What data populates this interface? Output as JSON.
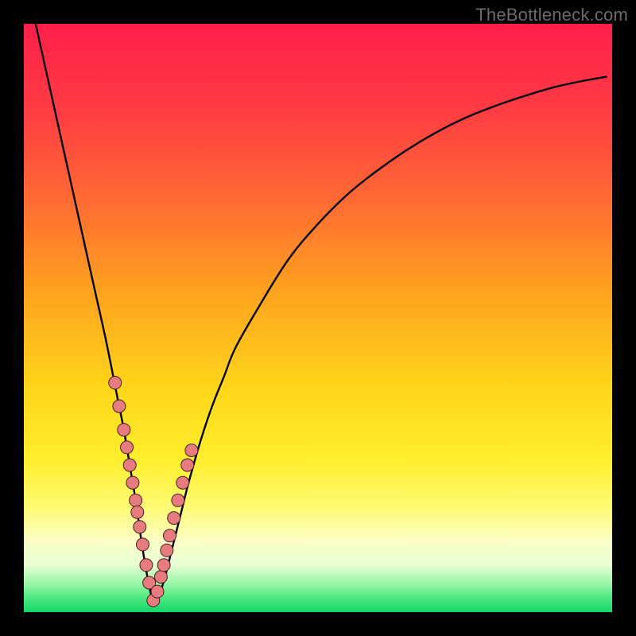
{
  "watermark": "TheBottleneck.com",
  "colors": {
    "frame": "#000000",
    "curve": "#000000",
    "marker_fill": "#e77c80",
    "marker_stroke": "#4a1f1f",
    "gradient_stops": [
      {
        "offset": 0.0,
        "color": "#ff1f4a"
      },
      {
        "offset": 0.14,
        "color": "#ff3a44"
      },
      {
        "offset": 0.3,
        "color": "#ff6a33"
      },
      {
        "offset": 0.46,
        "color": "#ffa41f"
      },
      {
        "offset": 0.62,
        "color": "#ffd61a"
      },
      {
        "offset": 0.74,
        "color": "#ffee2d"
      },
      {
        "offset": 0.82,
        "color": "#fffb72"
      },
      {
        "offset": 0.88,
        "color": "#fcffc6"
      },
      {
        "offset": 0.92,
        "color": "#e7ffd4"
      },
      {
        "offset": 0.95,
        "color": "#9ff7a8"
      },
      {
        "offset": 0.975,
        "color": "#4eea80"
      },
      {
        "offset": 1.0,
        "color": "#12d66a"
      }
    ]
  },
  "chart_data": {
    "type": "line",
    "title": "",
    "xlabel": "",
    "ylabel": "",
    "xlim": [
      0,
      100
    ],
    "ylim": [
      0,
      100
    ],
    "x_optimum": 22,
    "series": [
      {
        "name": "bottleneck-curve",
        "x": [
          2,
          4,
          6,
          8,
          10,
          12,
          14,
          16,
          17,
          18,
          19,
          20,
          21,
          22,
          23,
          24,
          25,
          26,
          27,
          28,
          30,
          32,
          34,
          36,
          40,
          45,
          50,
          55,
          60,
          65,
          70,
          75,
          80,
          85,
          90,
          95,
          99
        ],
        "y": [
          100,
          91,
          82,
          73,
          64,
          55,
          46,
          36,
          31,
          25,
          19,
          12,
          6,
          2,
          3,
          6,
          10,
          14,
          18,
          22,
          29,
          35,
          40,
          45,
          52,
          60,
          66,
          71,
          75,
          78.5,
          81.5,
          84,
          86,
          87.7,
          89.2,
          90.3,
          91
        ]
      }
    ],
    "markers": {
      "name": "highlight-points",
      "x": [
        15.5,
        16.2,
        17.0,
        17.5,
        18.0,
        18.5,
        19.0,
        19.3,
        19.7,
        20.2,
        20.8,
        21.3,
        22.0,
        22.7,
        23.3,
        23.8,
        24.3,
        24.8,
        25.5,
        26.2,
        27.0,
        27.8,
        28.5
      ],
      "y": [
        39,
        35,
        31,
        28,
        25,
        22,
        19,
        17,
        14.5,
        11.5,
        8,
        5,
        2,
        3.5,
        6,
        8,
        10.5,
        13,
        16,
        19,
        22,
        25,
        27.5
      ],
      "r": 8
    }
  }
}
